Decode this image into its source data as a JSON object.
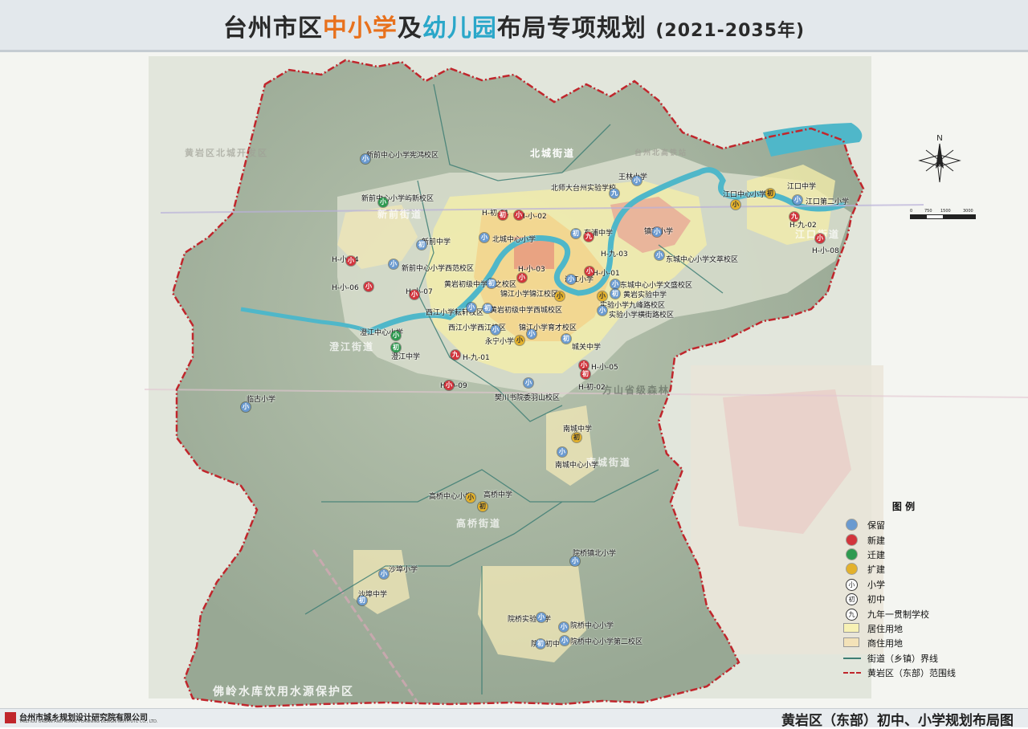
{
  "title": {
    "p1": "台州市区",
    "p2": "中小学",
    "p3": "及",
    "p4": "幼儿园",
    "p5": "布局",
    "p6": "专项规划",
    "year": "(2021-2035年)"
  },
  "colors": {
    "keep": "#6a9ad0",
    "new": "#d2343c",
    "move": "#2e9a50",
    "expand": "#e3b12c",
    "residential": "#f7f1b4",
    "commercial_residential": "#f3e2b8",
    "street_boundary": "#3e7e74",
    "district_boundary": "#c0262c",
    "river": "#4fb7c9"
  },
  "map_places": [
    "北城街道",
    "新前街道",
    "澄江街道",
    "南城街道",
    "高桥街道",
    "江口街道",
    "方山省级森林",
    "佛岭水库饮用水源保护区",
    "黄岩区北城开发区",
    "台州北高铁站"
  ],
  "schools": [
    {
      "name": "新前中心小学宪鸿校区",
      "code": "小",
      "status": "keep"
    },
    {
      "name": "新前中心小学屿新校区",
      "code": "小",
      "status": "move"
    },
    {
      "name": "新前中学",
      "code": "初",
      "status": "keep"
    },
    {
      "name": "H-小-04",
      "code": "小",
      "status": "new"
    },
    {
      "name": "新前中心小学西范校区",
      "code": "小",
      "status": "keep"
    },
    {
      "name": "H-小-06",
      "code": "小",
      "status": "new"
    },
    {
      "name": "H-小-07",
      "code": "小",
      "status": "new"
    },
    {
      "name": "西江小学耘轩校区",
      "code": "小",
      "status": "keep"
    },
    {
      "name": "黄岩初级中学成之校区",
      "code": "初",
      "status": "keep"
    },
    {
      "name": "H-初-01",
      "code": "初",
      "status": "new"
    },
    {
      "name": "H-小-02",
      "code": "小",
      "status": "new"
    },
    {
      "name": "北城中心小学",
      "code": "小",
      "status": "keep"
    },
    {
      "name": "北师大台州实验学校",
      "code": "九",
      "status": "keep"
    },
    {
      "name": "王林小学",
      "code": "小",
      "status": "keep"
    },
    {
      "name": "东浦中学",
      "code": "初",
      "status": "keep"
    },
    {
      "name": "H-九-03",
      "code": "九",
      "status": "new"
    },
    {
      "name": "镇东小学",
      "code": "小",
      "status": "keep"
    },
    {
      "name": "东城中心小学文萃校区",
      "code": "小",
      "status": "keep"
    },
    {
      "name": "江口中心小学",
      "code": "小",
      "status": "expand"
    },
    {
      "name": "江口中学",
      "code": "初",
      "status": "expand"
    },
    {
      "name": "江口第二小学",
      "code": "小",
      "status": "keep"
    },
    {
      "name": "H-九-02",
      "code": "九",
      "status": "new"
    },
    {
      "name": "H-小-08",
      "code": "小",
      "status": "new"
    },
    {
      "name": "H-小-03",
      "code": "小",
      "status": "new"
    },
    {
      "name": "滨江小学",
      "code": "小",
      "status": "keep"
    },
    {
      "name": "H-小-01",
      "code": "小",
      "status": "new"
    },
    {
      "name": "东城中心小学文盛校区",
      "code": "小",
      "status": "keep"
    },
    {
      "name": "黄岩实验中学",
      "code": "初",
      "status": "keep"
    },
    {
      "name": "锦江小学锦江校区",
      "code": "小",
      "status": "expand"
    },
    {
      "name": "实验小学九峰路校区",
      "code": "小",
      "status": "expand"
    },
    {
      "name": "黄岩初级中学西城校区",
      "code": "初",
      "status": "keep"
    },
    {
      "name": "实验小学横街路校区",
      "code": "小",
      "status": "keep"
    },
    {
      "name": "西江小学西江校区",
      "code": "小",
      "status": "keep"
    },
    {
      "name": "锦江小学育才校区",
      "code": "小",
      "status": "keep"
    },
    {
      "name": "澄江中心小学",
      "code": "小",
      "status": "move"
    },
    {
      "name": "澄江中学",
      "code": "初",
      "status": "move"
    },
    {
      "name": "永宁小学",
      "code": "小",
      "status": "expand"
    },
    {
      "name": "城关中学",
      "code": "初",
      "status": "keep"
    },
    {
      "name": "H-九-01",
      "code": "九",
      "status": "new"
    },
    {
      "name": "H-小-05",
      "code": "小",
      "status": "new"
    },
    {
      "name": "H-初-02",
      "code": "初",
      "status": "new"
    },
    {
      "name": "H-小-09",
      "code": "小",
      "status": "new"
    },
    {
      "name": "樊川书院委羽山校区",
      "code": "小",
      "status": "keep"
    },
    {
      "name": "临古小学",
      "code": "小",
      "status": "keep"
    },
    {
      "name": "南城中学",
      "code": "初",
      "status": "expand"
    },
    {
      "name": "南城中心小学",
      "code": "小",
      "status": "keep"
    },
    {
      "name": "高桥中心小学",
      "code": "小",
      "status": "expand"
    },
    {
      "name": "高桥中学",
      "code": "初",
      "status": "expand"
    },
    {
      "name": "院桥镇北小学",
      "code": "小",
      "status": "keep"
    },
    {
      "name": "沙埠小学",
      "code": "小",
      "status": "keep"
    },
    {
      "name": "沙埠中学",
      "code": "初",
      "status": "keep"
    },
    {
      "name": "院桥实验小学",
      "code": "小",
      "status": "keep"
    },
    {
      "name": "院桥中心小学",
      "code": "小",
      "status": "keep"
    },
    {
      "name": "院桥中心小学第二校区",
      "code": "小",
      "status": "keep"
    },
    {
      "name": "院桥初中",
      "code": "初",
      "status": "keep"
    }
  ],
  "legend": {
    "title": "图  例",
    "items": [
      {
        "label": "保留",
        "icon": "blue-dot"
      },
      {
        "label": "新建",
        "icon": "red-dot"
      },
      {
        "label": "迁建",
        "icon": "green-dot"
      },
      {
        "label": "扩建",
        "icon": "yellow-dot"
      },
      {
        "label": "小学",
        "icon": "primary-glyph",
        "glyph": "小"
      },
      {
        "label": "初中",
        "icon": "junior-glyph",
        "glyph": "初"
      },
      {
        "label": "九年一贯制学校",
        "icon": "nine-year-glyph",
        "glyph": "九"
      },
      {
        "label": "居住用地",
        "icon": "residential-swatch"
      },
      {
        "label": "商住用地",
        "icon": "commercial-swatch"
      },
      {
        "label": "街道（乡镇）界线",
        "icon": "boundary-line"
      },
      {
        "label": "黄岩区（东部）范围线",
        "icon": "district-line"
      }
    ]
  },
  "compass": {
    "north": "N"
  },
  "scale": {
    "t0": "0",
    "t1": "750",
    "t2": "1500",
    "t3": "3000 m"
  },
  "footer": {
    "org": "台州市城乡规划设计研究院有限公司",
    "org_en": "TAIZHOU URBAN AND RURAL PLANNING DESIGN INSTITUTE CO., LTD.",
    "map_title": "黄岩区（东部）初中、小学规划布局图"
  }
}
